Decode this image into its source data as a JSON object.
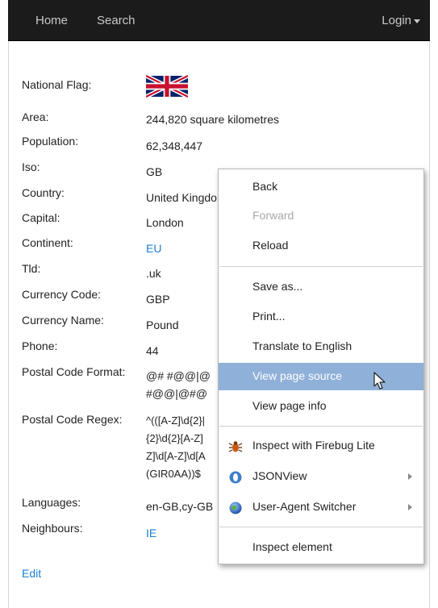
{
  "nav": {
    "home": "Home",
    "search": "Search",
    "login": "Login"
  },
  "country": {
    "rows": [
      {
        "label": "National Flag:",
        "value": ""
      },
      {
        "label": "Area:",
        "value": "244,820 square kilometres"
      },
      {
        "label": "Population:",
        "value": "62,348,447"
      },
      {
        "label": "Iso:",
        "value": "GB"
      },
      {
        "label": "Country:",
        "value": "United Kingdom"
      },
      {
        "label": "Capital:",
        "value": "London"
      },
      {
        "label": "Continent:",
        "value": "EU"
      },
      {
        "label": "Tld:",
        "value": ".uk"
      },
      {
        "label": "Currency Code:",
        "value": "GBP"
      },
      {
        "label": "Currency Name:",
        "value": "Pound"
      },
      {
        "label": "Phone:",
        "value": "44"
      },
      {
        "label": "Postal Code Format:",
        "value_lines": [
          "@# #@@|@",
          "#@@|@#@"
        ]
      },
      {
        "label": "Postal Code Regex:",
        "value_lines": [
          "^(([A-Z]\\d{2}|",
          "{2}\\d{2}[A-Z]",
          "Z]\\d[A-Z]\\d[A",
          "(GIR0AA))$"
        ]
      },
      {
        "label": "Languages:",
        "value": "en-GB,cy-GB"
      },
      {
        "label": "Neighbours:",
        "value": "IE"
      }
    ]
  },
  "edit_label": "Edit",
  "context_menu": {
    "back": "Back",
    "forward": "Forward",
    "reload": "Reload",
    "save_as": "Save as...",
    "print": "Print...",
    "translate": "Translate to English",
    "view_source": "View page source",
    "view_info": "View page info",
    "firebug": "Inspect with Firebug Lite",
    "jsonview": "JSONView",
    "ua_switcher": "User-Agent Switcher",
    "inspect": "Inspect element"
  },
  "colors": {
    "navbar_bg": "#1b1b1b",
    "link": "#1a7fd1",
    "menu_highlight": "#8fb0d8"
  },
  "icons": {
    "firebug": "firebug-icon",
    "jsonview": "jsonview-icon",
    "ua_switcher": "globe-icon"
  }
}
